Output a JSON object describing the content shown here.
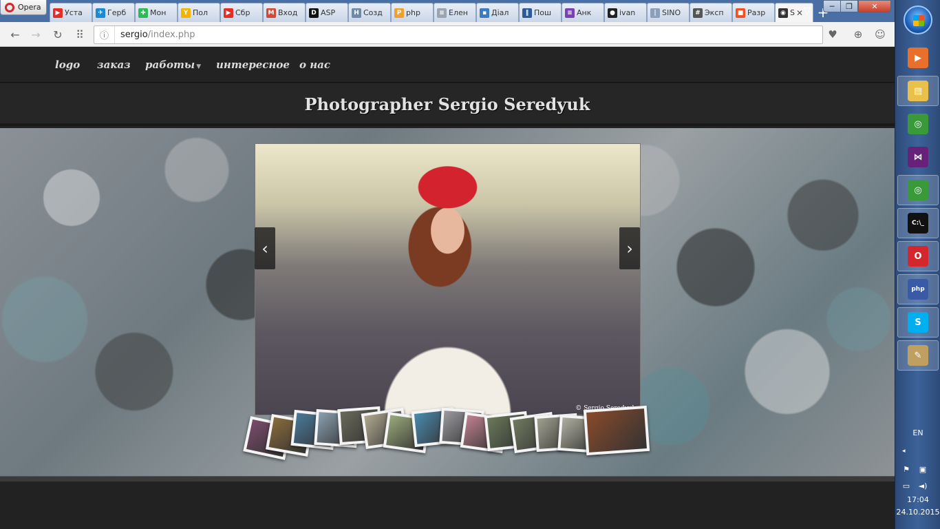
{
  "browser": {
    "menu_label": "Opera",
    "tabs": [
      {
        "label": "Уста",
        "favicon": "youtube-icon",
        "color": "#e52d27",
        "glyph": "▶"
      },
      {
        "label": "Герб",
        "favicon": "bird-icon",
        "color": "#1a8ad4",
        "glyph": "✈"
      },
      {
        "label": "Мон",
        "favicon": "globe-icon",
        "color": "#2dbb56",
        "glyph": "✚"
      },
      {
        "label": "Пол",
        "favicon": "yandex-icon",
        "color": "#f4b400",
        "glyph": "Y"
      },
      {
        "label": "Сбр",
        "favicon": "youtube-icon",
        "color": "#e52d27",
        "glyph": "▶"
      },
      {
        "label": "Вход",
        "favicon": "gmail-icon",
        "color": "#d14836",
        "glyph": "M"
      },
      {
        "label": "ASP",
        "favicon": "dou-icon",
        "color": "#111111",
        "glyph": "D"
      },
      {
        "label": "Созд",
        "favicon": "habr-icon",
        "color": "#6f8aa8",
        "glyph": "H"
      },
      {
        "label": "php",
        "favicon": "pma-icon",
        "color": "#f0a030",
        "glyph": "P"
      },
      {
        "label": "Елен",
        "favicon": "page-icon",
        "color": "#9aa5b1",
        "glyph": "≡"
      },
      {
        "label": "Діал",
        "favicon": "chat-icon",
        "color": "#3b7bbf",
        "glyph": "▪"
      },
      {
        "label": "Пош",
        "favicon": "pause-icon",
        "color": "#2a5a9a",
        "glyph": "‖"
      },
      {
        "label": "Анк",
        "favicon": "form-icon",
        "color": "#7b3fb5",
        "glyph": "≡"
      },
      {
        "label": "ivan",
        "favicon": "github-icon",
        "color": "#222222",
        "glyph": "●"
      },
      {
        "label": "SINO",
        "favicon": "thermometer-icon",
        "color": "#8aa0b8",
        "glyph": "|"
      },
      {
        "label": "Эксп",
        "favicon": "grid-icon",
        "color": "#555555",
        "glyph": "#"
      },
      {
        "label": "Разр",
        "favicon": "windows-icon",
        "color": "#f25022",
        "glyph": "■"
      },
      {
        "label": "S",
        "favicon": "camera-icon",
        "color": "#333333",
        "glyph": "◉",
        "active": true
      }
    ],
    "new_tab": "+",
    "url_host": "sergio",
    "url_path": "/index.php"
  },
  "site": {
    "nav": [
      {
        "label": "logo"
      },
      {
        "label": "заказ"
      },
      {
        "label": "работы",
        "dropdown": true
      },
      {
        "label": "интересное"
      },
      {
        "label": "о нас"
      }
    ],
    "title": "Photographer Sergio Seredyuk",
    "photo_credit": "© Sergio Seredyuk",
    "prev": "‹",
    "next": "›",
    "thumbnails": [
      {
        "name": "thumb-1",
        "color": "#7a4b6a"
      },
      {
        "name": "thumb-2",
        "color": "#8a6a3a"
      },
      {
        "name": "thumb-3",
        "color": "#4a7a9a"
      },
      {
        "name": "thumb-4",
        "color": "#8aa0b0"
      },
      {
        "name": "thumb-5",
        "color": "#6a6a5a"
      },
      {
        "name": "thumb-6",
        "color": "#b0a890"
      },
      {
        "name": "thumb-7",
        "color": "#9aaa7a"
      },
      {
        "name": "thumb-8",
        "color": "#4a8ab0"
      },
      {
        "name": "thumb-9",
        "color": "#9a9aa0"
      },
      {
        "name": "thumb-10",
        "color": "#c08090"
      },
      {
        "name": "thumb-11",
        "color": "#6a7a5a"
      },
      {
        "name": "thumb-12",
        "color": "#707a60"
      },
      {
        "name": "thumb-13",
        "color": "#a0a090"
      },
      {
        "name": "thumb-14",
        "color": "#b0b0a0"
      },
      {
        "name": "thumb-15",
        "color": "#8a4a2a"
      }
    ]
  },
  "taskbar": {
    "apps": [
      {
        "name": "media-player-icon",
        "color": "#e8702a",
        "glyph": "▶",
        "running": false
      },
      {
        "name": "file-explorer-icon",
        "color": "#e8c04a",
        "glyph": "▤",
        "running": true
      },
      {
        "name": "chrome-icon",
        "color": "#3a9a3a",
        "glyph": "◎",
        "running": false
      },
      {
        "name": "visual-studio-icon",
        "color": "#68217a",
        "glyph": "⋈",
        "running": false
      },
      {
        "name": "chrome-icon",
        "color": "#3a9a3a",
        "glyph": "◎",
        "running": true
      },
      {
        "name": "command-prompt-icon",
        "color": "#111111",
        "glyph": "C:\\_",
        "running": true
      },
      {
        "name": "opera-icon",
        "color": "#d3262d",
        "glyph": "O",
        "running": true
      },
      {
        "name": "php-designer-icon",
        "color": "#3a5aa8",
        "glyph": "php",
        "running": true
      },
      {
        "name": "skype-icon",
        "color": "#00aff0",
        "glyph": "S",
        "running": true
      },
      {
        "name": "paint-icon",
        "color": "#c0a060",
        "glyph": "✎",
        "running": true
      }
    ],
    "language": "EN",
    "time": "17:04",
    "date": "24.10.2015"
  }
}
